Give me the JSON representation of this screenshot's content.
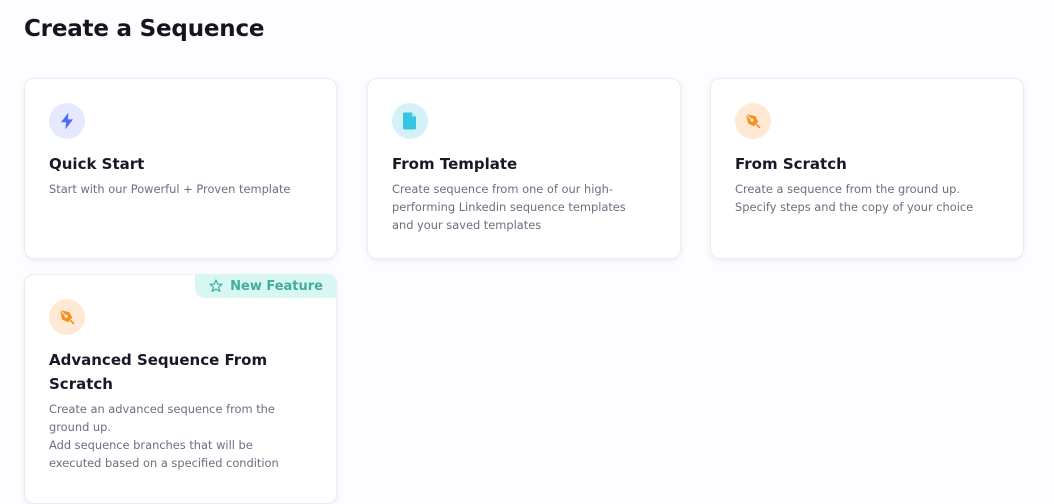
{
  "page": {
    "title": "Create a Sequence"
  },
  "cards": [
    {
      "title": "Quick Start",
      "icon": "lightning-icon",
      "icon_color": "#4a6cf7",
      "description": [
        "Start with our Powerful + Proven template"
      ]
    },
    {
      "title": "From Template",
      "icon": "document-icon",
      "icon_color": "#38c5e2",
      "description": [
        "Create sequence from one of our high-",
        "performing Linkedin sequence templates",
        "and your saved templates"
      ]
    },
    {
      "title": "From Scratch",
      "icon": "pen-icon",
      "icon_color": "#f3901f",
      "description": [
        "Create a sequence from the ground up.",
        "Specify steps and the copy of your choice"
      ]
    },
    {
      "title_line1": "Advanced Sequence From",
      "title_line2": "Scratch",
      "icon": "pen-icon",
      "icon_color": "#f3901f",
      "badge": "New Feature",
      "badge_icon": "star-icon",
      "description": [
        "Create an advanced sequence from the",
        "ground up.",
        "Add sequence branches that will be",
        "executed based on a specified condition"
      ]
    }
  ]
}
